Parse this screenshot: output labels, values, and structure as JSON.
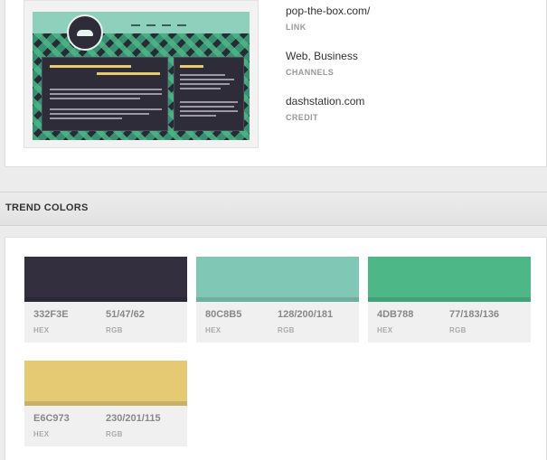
{
  "details": {
    "link_value": "pop-the-box.com/",
    "link_label": "LINK",
    "channels_value": "Web, Business",
    "channels_label": "CHANNELS",
    "credit_value": "dashstation.com",
    "credit_label": "CREDIT"
  },
  "section": {
    "title": "TREND COLORS"
  },
  "swatches": [
    {
      "hex": "332F3E",
      "rgb": "51/47/62",
      "hex_label": "HEX",
      "rgb_label": "RGB",
      "color": "#332F3E"
    },
    {
      "hex": "80C8B5",
      "rgb": "128/200/181",
      "hex_label": "HEX",
      "rgb_label": "RGB",
      "color": "#80C8B5"
    },
    {
      "hex": "4DB788",
      "rgb": "77/183/136",
      "hex_label": "HEX",
      "rgb_label": "RGB",
      "color": "#4DB788"
    },
    {
      "hex": "E6C973",
      "rgb": "230/201/115",
      "hex_label": "HEX",
      "rgb_label": "RGB",
      "color": "#E6C973"
    }
  ]
}
